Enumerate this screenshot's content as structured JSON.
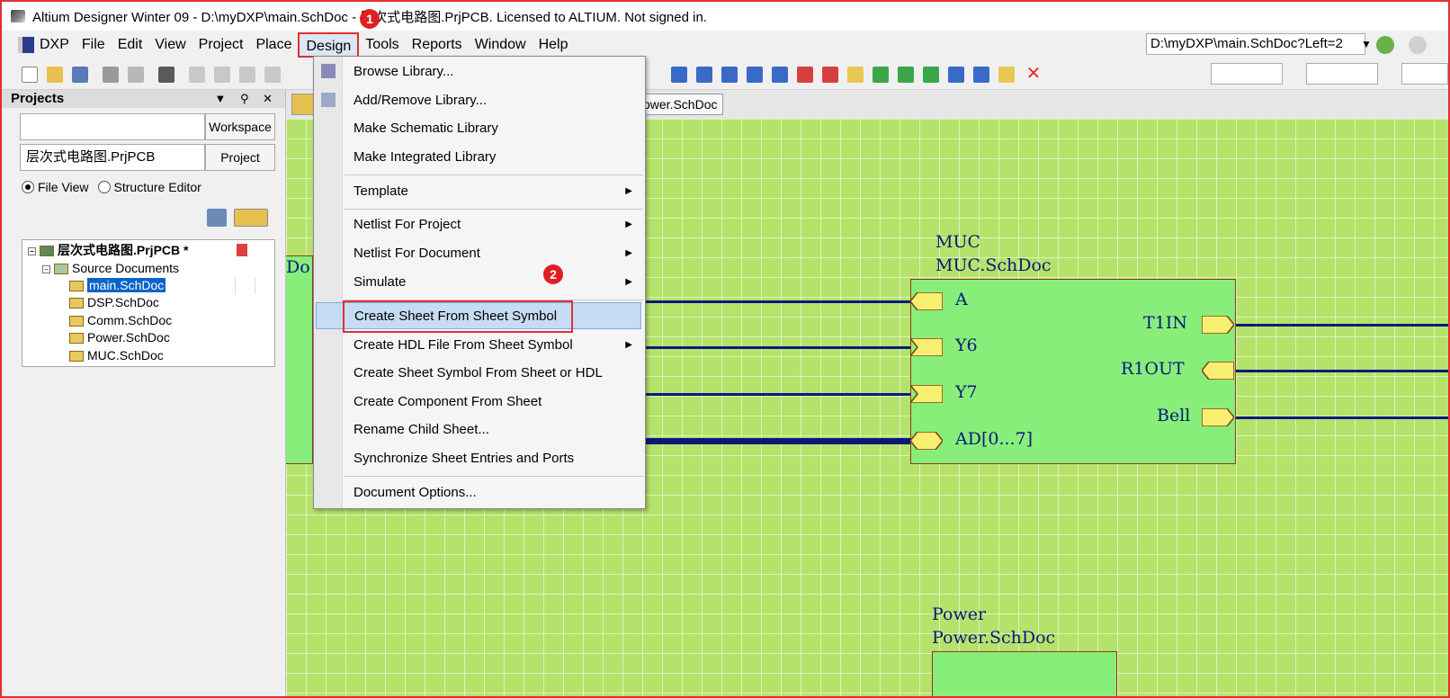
{
  "window": {
    "title": "Altium Designer Winter 09 - D:\\myDXP\\main.SchDoc - 层次式电路图.PrjPCB. Licensed to ALTIUM. Not signed in."
  },
  "menubar": {
    "items": [
      "DXP",
      "File",
      "Edit",
      "View",
      "Project",
      "Place",
      "Design",
      "Tools",
      "Reports",
      "Window",
      "Help"
    ],
    "path": "D:\\myDXP\\main.SchDoc?Left=2"
  },
  "projects_panel": {
    "title": "Projects",
    "workspace_value": "",
    "workspace_button": "Workspace",
    "project_value": "层次式电路图.PrjPCB",
    "project_button": "Project",
    "view_options": [
      "File View",
      "Structure Editor"
    ],
    "selected_view": "File View",
    "tree": {
      "project": "层次式电路图.PrjPCB *",
      "folder": "Source Documents",
      "documents": [
        "main.SchDoc",
        "DSP.SchDoc",
        "Comm.SchDoc",
        "Power.SchDoc",
        "MUC.SchDoc"
      ],
      "selected_document": "main.SchDoc"
    }
  },
  "tabs": {
    "visible_tab_fragment": "ower.SchDoc"
  },
  "design_menu": {
    "items": [
      {
        "label": "Browse Library...",
        "submenu": false
      },
      {
        "label": "Add/Remove Library...",
        "submenu": false
      },
      {
        "label": "Make Schematic Library",
        "submenu": false
      },
      {
        "label": "Make Integrated Library",
        "submenu": false
      },
      {
        "label": "Template",
        "submenu": true
      },
      {
        "label": "Netlist For Project",
        "submenu": true
      },
      {
        "label": "Netlist For Document",
        "submenu": true
      },
      {
        "label": "Simulate",
        "submenu": true
      },
      {
        "label": "Create Sheet From Sheet Symbol",
        "submenu": false,
        "highlighted": true
      },
      {
        "label": "Create HDL File From Sheet Symbol",
        "submenu": true
      },
      {
        "label": "Create Sheet Symbol From Sheet or HDL",
        "submenu": false
      },
      {
        "label": "Create Component From Sheet",
        "submenu": false
      },
      {
        "label": "Rename Child Sheet...",
        "submenu": false
      },
      {
        "label": "Synchronize Sheet Entries and Ports",
        "submenu": false
      },
      {
        "label": "Document Options...",
        "submenu": false
      }
    ]
  },
  "annotations": {
    "step1": "1",
    "step2": "2"
  },
  "schematic": {
    "partial_label": "Do",
    "muc_sheet": {
      "designator": "MUC",
      "filename": "MUC.SchDoc",
      "left_ports": [
        "A",
        "Y6",
        "Y7",
        "AD[0...7]"
      ],
      "right_ports": [
        "T1IN",
        "R1OUT",
        "Bell"
      ]
    },
    "power_sheet": {
      "designator": "Power",
      "filename": "Power.SchDoc"
    }
  },
  "colors": {
    "sheet_bg": "#b5e26a",
    "sheet_symbol_fill": "#88ee7a",
    "wire": "#0a1a7a",
    "highlight": "#c4dcf4",
    "annotation_red": "#e03030"
  }
}
